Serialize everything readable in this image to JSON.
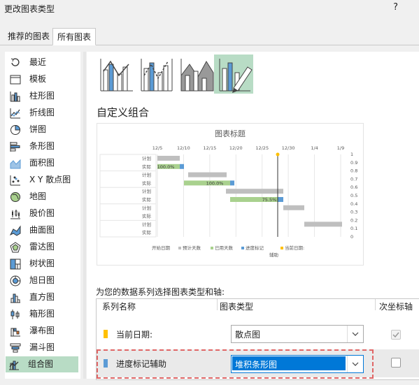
{
  "window": {
    "title": "更改图表类型",
    "help": "?"
  },
  "tabs": [
    "推荐的图表",
    "所有图表"
  ],
  "sidebar": {
    "items": [
      {
        "label": "最近",
        "icon": "recent-icon"
      },
      {
        "label": "模板",
        "icon": "template-icon"
      },
      {
        "label": "柱形图",
        "icon": "column-chart-icon"
      },
      {
        "label": "折线图",
        "icon": "line-chart-icon"
      },
      {
        "label": "饼图",
        "icon": "pie-chart-icon"
      },
      {
        "label": "条形图",
        "icon": "bar-chart-icon"
      },
      {
        "label": "面积图",
        "icon": "area-chart-icon"
      },
      {
        "label": "X Y 散点图",
        "icon": "scatter-chart-icon"
      },
      {
        "label": "地图",
        "icon": "map-chart-icon"
      },
      {
        "label": "股价图",
        "icon": "stock-chart-icon"
      },
      {
        "label": "曲面图",
        "icon": "surface-chart-icon"
      },
      {
        "label": "雷达图",
        "icon": "radar-chart-icon"
      },
      {
        "label": "树状图",
        "icon": "treemap-icon"
      },
      {
        "label": "旭日图",
        "icon": "sunburst-icon"
      },
      {
        "label": "直方图",
        "icon": "histogram-icon"
      },
      {
        "label": "箱形图",
        "icon": "box-whisker-icon"
      },
      {
        "label": "瀑布图",
        "icon": "waterfall-icon"
      },
      {
        "label": "漏斗图",
        "icon": "funnel-icon"
      },
      {
        "label": "组合图",
        "icon": "combo-chart-icon"
      }
    ]
  },
  "section_title": "自定义组合",
  "preview": {
    "title": "图表标题",
    "x_ticks": [
      "12/5",
      "12/10",
      "12/15",
      "12/20",
      "12/25",
      "12/30",
      "1/4",
      "1/9"
    ],
    "y2_ticks": [
      "1",
      "0.9",
      "0.8",
      "0.7",
      "0.6",
      "0.5",
      "0.4",
      "0.3",
      "0.2",
      "0.1",
      "0"
    ],
    "sub_labels": [
      "计划",
      "实际",
      "计划",
      "实际",
      "计划",
      "实际",
      "计划",
      "实际",
      "计划",
      "实际"
    ],
    "pct_labels": [
      "100.0%",
      "100.0%",
      "75.5%"
    ],
    "legend": [
      {
        "label": "开始日期",
        "color": "#ffffff"
      },
      {
        "label": "预计天数",
        "color": "#bfbfbf"
      },
      {
        "label": "已用天数",
        "color": "#a9d18e"
      },
      {
        "label": "进度标记",
        "color": "#5b9bd5"
      },
      {
        "label": "辅助",
        "color": ""
      },
      {
        "label": "当前日期:",
        "color": "#ffc000"
      }
    ]
  },
  "prompt": "为您的数据系列选择图表类型和轴:",
  "grid": {
    "headers": [
      "系列名称",
      "图表类型",
      "次坐标轴"
    ],
    "rows": [
      {
        "name": "当前日期:",
        "type": "散点图",
        "secondary": true,
        "color": "#ffc000"
      },
      {
        "name": "进度标记辅助",
        "type": "堆积条形图",
        "secondary": false,
        "color": "#5b9bd5"
      }
    ]
  }
}
